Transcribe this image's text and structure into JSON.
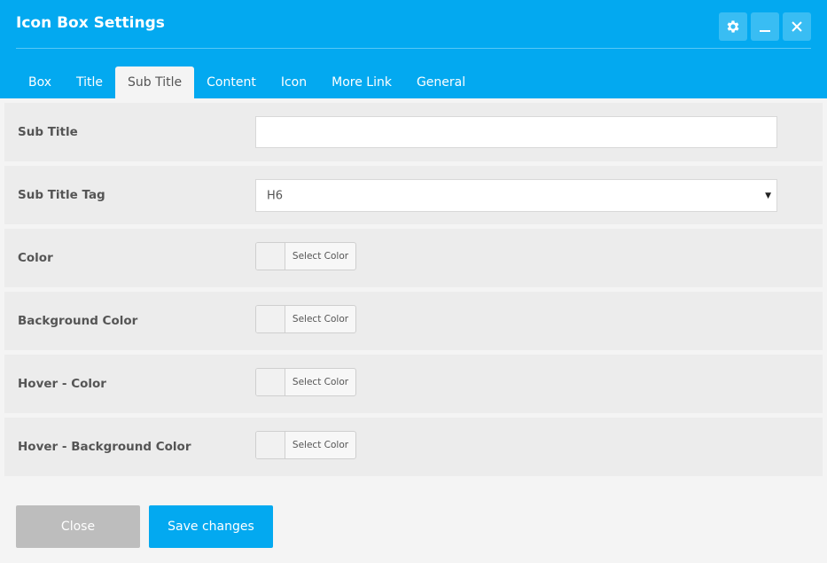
{
  "window": {
    "title": "Icon Box Settings",
    "accent_color": "#03a9f0",
    "buttons": {
      "settings": "gear-icon",
      "minimize": "minimize-icon",
      "close": "close-icon"
    }
  },
  "tabs": [
    {
      "label": "Box",
      "active": false
    },
    {
      "label": "Title",
      "active": false
    },
    {
      "label": "Sub Title",
      "active": true
    },
    {
      "label": "Content",
      "active": false
    },
    {
      "label": "Icon",
      "active": false
    },
    {
      "label": "More Link",
      "active": false
    },
    {
      "label": "General",
      "active": false
    }
  ],
  "fields": {
    "sub_title": {
      "label": "Sub Title",
      "value": "",
      "placeholder": ""
    },
    "sub_title_tag": {
      "label": "Sub Title Tag",
      "value": "H6"
    },
    "color": {
      "label": "Color",
      "button": "Select Color"
    },
    "background_color": {
      "label": "Background Color",
      "button": "Select Color"
    },
    "hover_color": {
      "label": "Hover - Color",
      "button": "Select Color"
    },
    "hover_background_color": {
      "label": "Hover - Background Color",
      "button": "Select Color"
    }
  },
  "footer": {
    "close_label": "Close",
    "save_label": "Save changes"
  }
}
